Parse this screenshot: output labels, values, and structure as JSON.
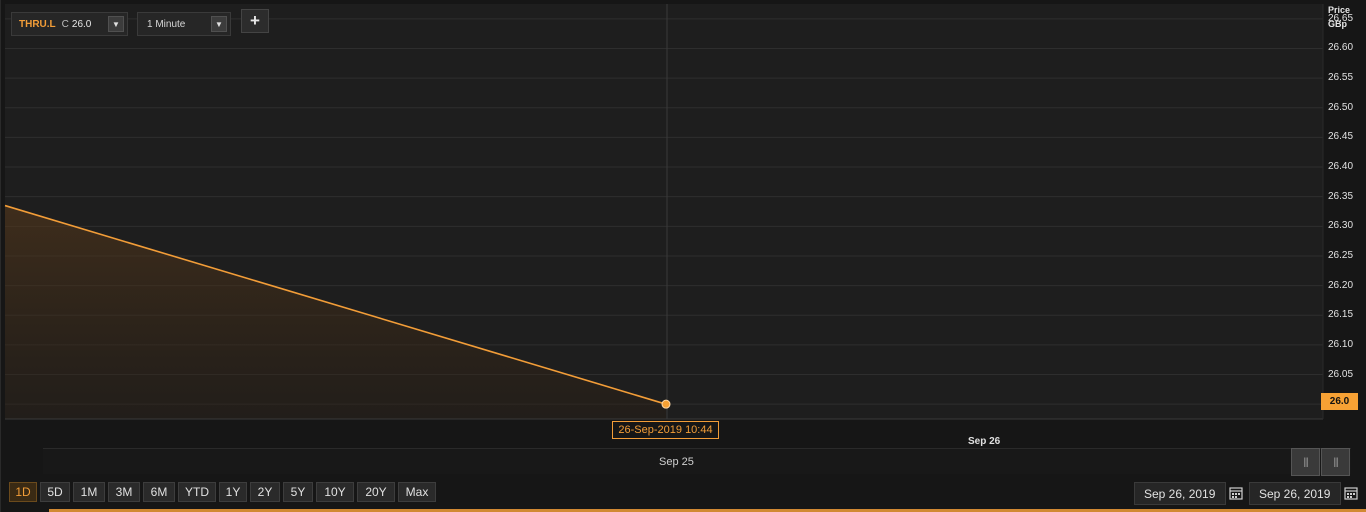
{
  "toolbar": {
    "instrument": {
      "ric": "THRU.L",
      "close_label": "C",
      "close_value": "26.0"
    },
    "interval": "1 Minute",
    "add_label": "+"
  },
  "axis": {
    "title": "Price",
    "unit": "GBp"
  },
  "crosshair": {
    "time_label": "26-Sep-2019 10:44",
    "price_label": "26.0"
  },
  "dates": {
    "upper": "Sep 26",
    "navigator": "Sep 25"
  },
  "range_buttons": [
    "1D",
    "5D",
    "1M",
    "3M",
    "6M",
    "YTD",
    "1Y",
    "2Y",
    "5Y",
    "10Y",
    "20Y",
    "Max"
  ],
  "active_range": "1D",
  "date_range": {
    "start": "Sep 26, 2019",
    "end": "Sep 26, 2019"
  },
  "colors": {
    "accent": "#f29d38",
    "background": "#1e1e1e",
    "grid": "#2e2e2e"
  },
  "chart_data": {
    "type": "area",
    "x": [
      "start",
      "26-Sep-2019 10:44"
    ],
    "y": [
      26.335,
      26.0
    ],
    "ylabel": "Price GBp",
    "yticks": [
      26.65,
      26.6,
      26.55,
      26.5,
      26.45,
      26.4,
      26.35,
      26.3,
      26.25,
      26.2,
      26.15,
      26.1,
      26.05
    ],
    "ylim": [
      25.975,
      26.675
    ],
    "grid": true
  }
}
